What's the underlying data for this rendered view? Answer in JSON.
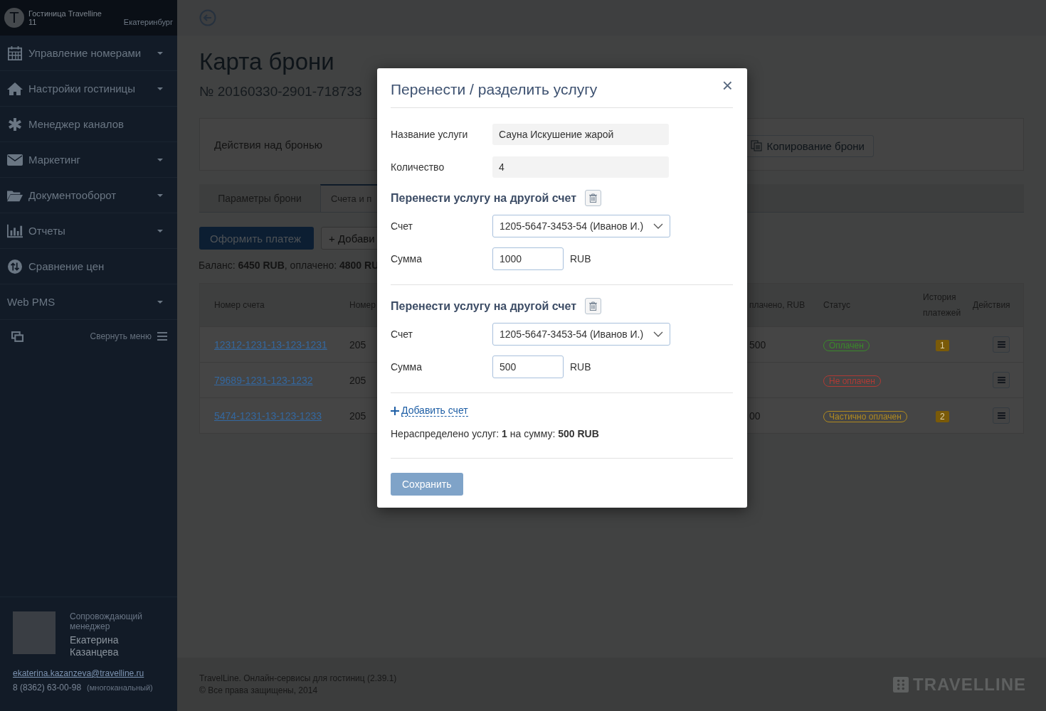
{
  "sidebar": {
    "hotel": {
      "avatar_letter": "T",
      "name": "Гостиница Travelline",
      "number": "11",
      "city": "Екатеринбург"
    },
    "menu": [
      {
        "label": "Управление номерами",
        "has_dropdown": true
      },
      {
        "label": "Настройки гостиницы",
        "has_dropdown": true
      },
      {
        "label": "Менеджер каналов",
        "has_dropdown": false
      },
      {
        "label": "Маркетинг",
        "has_dropdown": true
      },
      {
        "label": "Документооборот",
        "has_dropdown": true
      },
      {
        "label": "Отчеты",
        "has_dropdown": true
      },
      {
        "label": "Сравнение цен",
        "has_dropdown": false
      },
      {
        "label": "Web PMS",
        "has_dropdown": true
      }
    ],
    "collapse": {
      "label": "Свернуть меню"
    },
    "manager": {
      "role": "Сопровождающий менеджер",
      "name": "Екатерина Казанцева",
      "email": "ekaterina.kazanzeva@travelline.ru",
      "phone": "8 (8362) 63-00-98",
      "phone_note": "(многоканальный)"
    }
  },
  "page": {
    "title": "Карта брони",
    "booking_number": "№ 20160330-2901-718733",
    "actions": {
      "label": "Действия над бронью",
      "copy_button": "Копирование брони"
    },
    "tabs": [
      {
        "label": "Параметры брони",
        "selected": false
      },
      {
        "label": "Счета и п",
        "selected": true
      }
    ],
    "buttons": [
      {
        "label": "Оформить платеж",
        "kind": "primary"
      },
      {
        "label": "Добави",
        "kind": "add",
        "plus": "+"
      }
    ],
    "balance": "Баланс: **6450 RUB**, оплачено: **4800 RU**",
    "table": {
      "columns": [
        "Номер счета",
        "Номер",
        "плачено, RUB",
        "Статус",
        "История платежей",
        "Действия"
      ],
      "rows": [
        {
          "account": "12312-1231-13-123-1231",
          "number": "205",
          "paid": "500",
          "status": {
            "label": "Оплачен",
            "color": "#3a8a2a"
          },
          "history": "1"
        },
        {
          "account": "79689-1231-123-1232",
          "number": "205",
          "status": {
            "label": "Не оплачен",
            "color": "#b03a34"
          }
        },
        {
          "account": "5474-1231-13-123-1233",
          "number": "205",
          "paid": "00",
          "status": {
            "label": "Частично оплачен",
            "color": "#b08a20"
          },
          "history": "2"
        }
      ]
    }
  },
  "footer": {
    "line1": "TravelLine. Онлайн-сервисы для гостиниц (2.39.1)",
    "line2": "© Все права защищены, 2014",
    "logo": "TRAVELLINE"
  },
  "modal": {
    "title": "Перенести / разделить услугу",
    "close": "×",
    "fields": [
      {
        "label": "Название услуги",
        "value": "Сауна Искушение жарой"
      },
      {
        "label": "Количество",
        "value": "4"
      }
    ],
    "transfers": [
      {
        "heading": "Перенести услугу на другой счет",
        "account_label": "Счет",
        "account": "1205-5647-3453-54 (Иванов И.)",
        "sum_label": "Сумма",
        "sum": "1000",
        "currency": "RUB"
      },
      {
        "heading": "Перенести услугу на другой счет",
        "account_label": "Счет",
        "account": "1205-5647-3453-54 (Иванов И.)",
        "sum_label": "Сумма",
        "sum": "500",
        "currency": "RUB"
      }
    ],
    "add_account": "Добавить счет",
    "summary": "Нераспределено услуг: **1** на сумму: **500 RUB**",
    "save": {
      "label": "Сохранить",
      "disabled": true
    }
  }
}
